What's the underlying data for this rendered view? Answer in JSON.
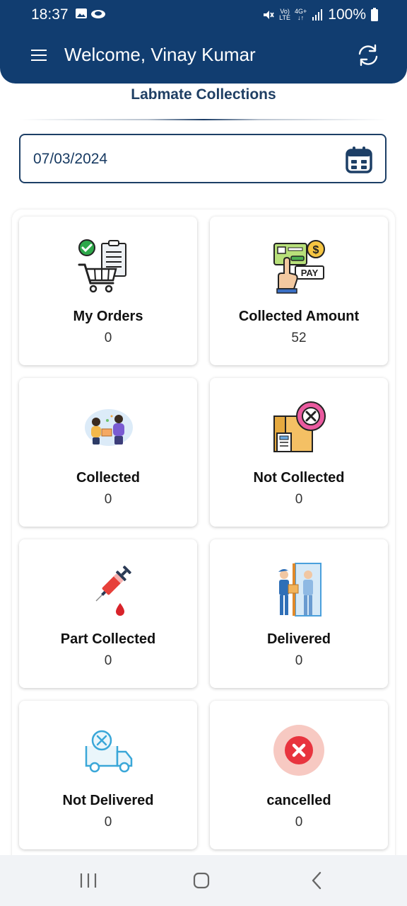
{
  "status_bar": {
    "time": "18:37",
    "network_top": "Vo)",
    "network_bottom": "LTE",
    "data_top": "4G+",
    "battery": "100%"
  },
  "header": {
    "title": "Welcome, Vinay Kumar"
  },
  "page": {
    "title": "Labmate Collections"
  },
  "date_field": {
    "value": "07/03/2024"
  },
  "cards": [
    {
      "label": "My Orders",
      "count": "0",
      "icon": "orders-cart-icon"
    },
    {
      "label": "Collected Amount",
      "count": "52",
      "icon": "pay-icon"
    },
    {
      "label": "Collected",
      "count": "0",
      "icon": "collected-people-icon"
    },
    {
      "label": "Not Collected",
      "count": "0",
      "icon": "not-collected-box-icon"
    },
    {
      "label": "Part Collected",
      "count": "0",
      "icon": "syringe-icon"
    },
    {
      "label": "Delivered",
      "count": "0",
      "icon": "delivery-man-icon"
    },
    {
      "label": "Not Delivered",
      "count": "0",
      "icon": "truck-cancel-icon"
    },
    {
      "label": "cancelled",
      "count": "0",
      "icon": "cancel-circle-icon"
    }
  ],
  "colors": {
    "header_bg": "#113d70",
    "title": "#1f3f64",
    "accent": "#1d3f66"
  }
}
